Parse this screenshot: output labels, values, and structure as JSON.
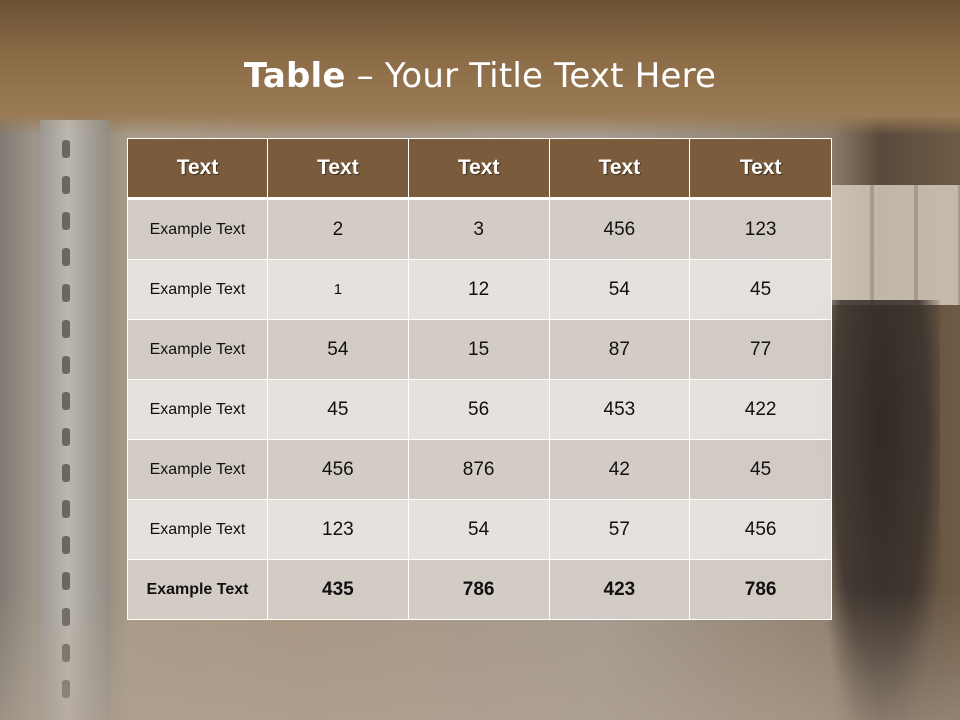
{
  "slide": {
    "title_bold": "Table",
    "title_rest": " – Your Title Text Here"
  },
  "table": {
    "headers": [
      "Text",
      "Text",
      "Text",
      "Text",
      "Text"
    ],
    "rows": [
      [
        "Example Text",
        "2",
        "3",
        "456",
        "123"
      ],
      [
        "Example Text",
        "1",
        "12",
        "54",
        "45"
      ],
      [
        "Example Text",
        "54",
        "15",
        "87",
        "77"
      ],
      [
        "Example Text",
        "45",
        "56",
        "453",
        "422"
      ],
      [
        "Example Text",
        "456",
        "876",
        "42",
        "45"
      ],
      [
        "Example Text",
        "123",
        "54",
        "57",
        "456"
      ],
      [
        "Example Text",
        "435",
        "786",
        "423",
        "786"
      ]
    ]
  },
  "colors": {
    "header_bg": "#7a5c3c",
    "row_odd": "#d4cec8",
    "row_even": "#e8e4e0"
  }
}
